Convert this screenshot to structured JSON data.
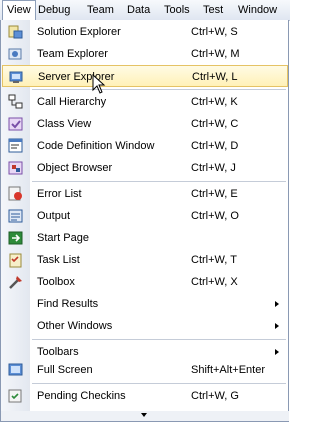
{
  "menubar": {
    "items": [
      "View",
      "Debug",
      "Team",
      "Data",
      "Tools",
      "Test",
      "Window"
    ]
  },
  "menu": {
    "items": [
      {
        "label": "Solution Explorer",
        "shortcut": "Ctrl+W, S",
        "icon": "solution-explorer-icon"
      },
      {
        "label": "Team Explorer",
        "shortcut": "Ctrl+W, M",
        "icon": "team-explorer-icon"
      },
      {
        "label": "Server Explorer",
        "shortcut": "Ctrl+W, L",
        "icon": "server-explorer-icon"
      },
      {
        "label": "Call Hierarchy",
        "shortcut": "Ctrl+W, K",
        "icon": "call-hierarchy-icon"
      },
      {
        "label": "Class View",
        "shortcut": "Ctrl+W, C",
        "icon": "class-view-icon"
      },
      {
        "label": "Code Definition Window",
        "shortcut": "Ctrl+W, D",
        "icon": "code-definition-icon"
      },
      {
        "label": "Object Browser",
        "shortcut": "Ctrl+W, J",
        "icon": "object-browser-icon"
      },
      {
        "label": "Error List",
        "shortcut": "Ctrl+W, E",
        "icon": "error-list-icon"
      },
      {
        "label": "Output",
        "shortcut": "Ctrl+W, O",
        "icon": "output-icon"
      },
      {
        "label": "Start Page",
        "shortcut": "",
        "icon": "start-page-icon"
      },
      {
        "label": "Task List",
        "shortcut": "Ctrl+W, T",
        "icon": "task-list-icon"
      },
      {
        "label": "Toolbox",
        "shortcut": "Ctrl+W, X",
        "icon": "toolbox-icon"
      },
      {
        "label": "Find Results",
        "shortcut": "",
        "icon": ""
      },
      {
        "label": "Other Windows",
        "shortcut": "",
        "icon": ""
      },
      {
        "label": "Toolbars",
        "shortcut": "",
        "icon": ""
      },
      {
        "label": "Full Screen",
        "shortcut": "Shift+Alt+Enter",
        "icon": "full-screen-icon"
      },
      {
        "label": "Pending Checkins",
        "shortcut": "Ctrl+W, G",
        "icon": "pending-checkins-icon"
      }
    ]
  },
  "colors": {
    "highlight_border": "#e5c365",
    "highlight_fill": "#fff1b8",
    "menu_border": "#8a99b3"
  }
}
